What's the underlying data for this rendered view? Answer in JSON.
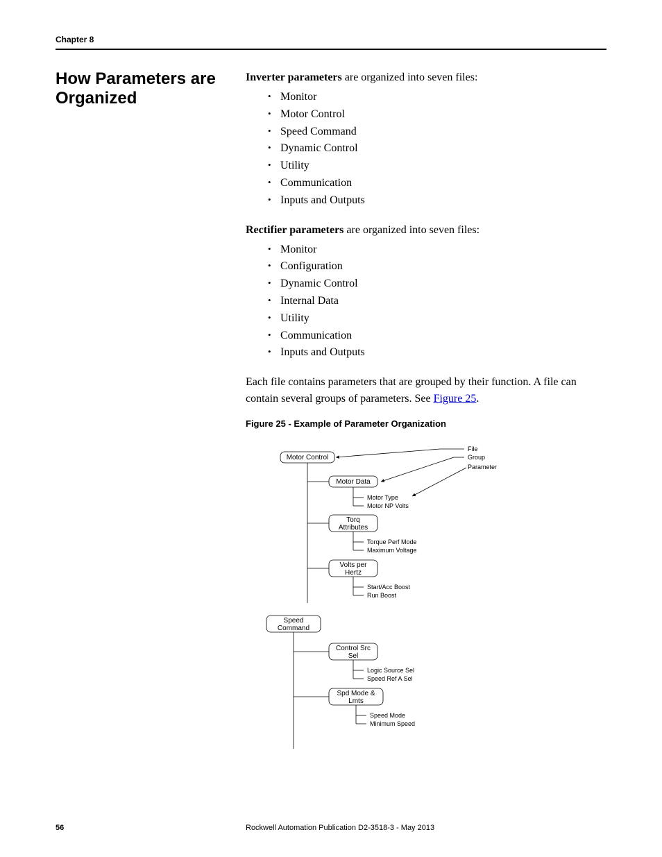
{
  "chapter_label": "Chapter 8",
  "section_title": "How Parameters are Organized",
  "body": {
    "inverter_intro_bold": "Inverter parameters",
    "inverter_intro_rest": " are organized into seven files:",
    "inverter_list": [
      "Monitor",
      "Motor Control",
      "Speed Command",
      "Dynamic Control",
      "Utility",
      "Communication",
      "Inputs and Outputs"
    ],
    "rectifier_intro_bold": "Rectifier parameters",
    "rectifier_intro_rest": " are organized into seven files:",
    "rectifier_list": [
      "Monitor",
      "Configuration",
      "Dynamic Control",
      "Internal Data",
      "Utility",
      "Communication",
      "Inputs and Outputs"
    ],
    "closing_para_before": "Each file contains parameters that are grouped by their function. A file can contain several groups of parameters. See ",
    "closing_link": "Figure 25",
    "closing_para_after": "."
  },
  "figure": {
    "caption": "Figure 25 - Example of Parameter Organization",
    "legend": {
      "file": "File",
      "group": "Group",
      "parameter": "Parameter"
    },
    "files": [
      {
        "name": "Motor Control",
        "groups": [
          {
            "name": "Motor Data",
            "params": [
              "Motor Type",
              "Motor NP Volts"
            ]
          },
          {
            "name": "Torq Attributes",
            "params": [
              "Torque Perf Mode",
              "Maximum Voltage"
            ]
          },
          {
            "name": "Volts per Hertz",
            "params": [
              "Start/Acc Boost",
              "Run Boost"
            ]
          }
        ]
      },
      {
        "name": "Speed Command",
        "groups": [
          {
            "name": "Control Src Sel",
            "params": [
              "Logic Source Sel",
              "Speed Ref A Sel"
            ]
          },
          {
            "name": "Spd Mode & Lmts",
            "params": [
              "Speed Mode",
              "Minimum Speed"
            ]
          }
        ]
      }
    ]
  },
  "footer": {
    "page_number": "56",
    "publication": "Rockwell Automation Publication D2-3518-3 - May 2013"
  }
}
